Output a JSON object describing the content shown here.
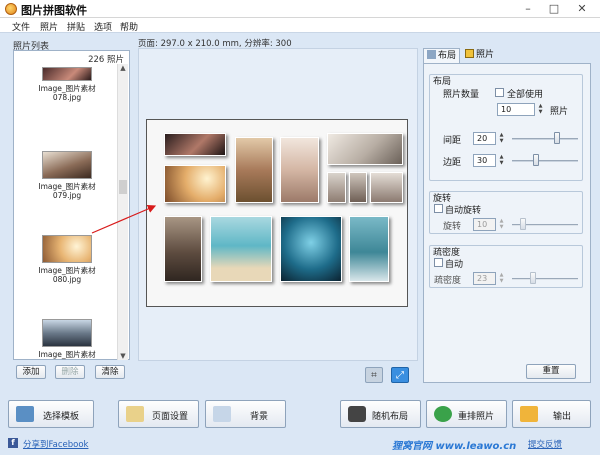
{
  "window": {
    "title": "图片拼图软件",
    "minimize": "–",
    "maximize": "□",
    "close": "✕"
  },
  "menu": [
    "文件",
    "照片",
    "拼贴",
    "选项",
    "帮助"
  ],
  "photo_list": {
    "title": "照片列表",
    "count": "226 照片",
    "items": [
      {
        "caption": "Image_图片素材\n078.jpg"
      },
      {
        "caption": "Image_图片素材\n079.jpg"
      },
      {
        "caption": "Image_图片素材\n080.jpg"
      },
      {
        "caption": "Image_图片素材"
      }
    ],
    "add_button": "添加",
    "delete_button": "删除",
    "clear_button": "清除"
  },
  "canvas": {
    "info": "页面: 297.0 x 210.0 mm, 分辨率: 300"
  },
  "tabs": {
    "layout": "布局",
    "photo": "照片"
  },
  "layout_group": {
    "label": "布局",
    "photo_count_label": "照片数量",
    "use_all_label": "全部使用",
    "photo_count_value": "10",
    "photo_unit": "照片",
    "spacing_label": "间距",
    "spacing_value": "20",
    "margin_label": "边距",
    "margin_value": "30"
  },
  "rotation_group": {
    "label": "旋转",
    "auto_label": "自动旋转",
    "rotate_label": "旋转",
    "rotate_value": "10"
  },
  "density_group": {
    "label": "疏密度",
    "auto_label": "自动",
    "density_label": "疏密度",
    "density_value": "23"
  },
  "reset_button": "重置",
  "bottom_buttons": {
    "template": "选择模板",
    "page_setup": "页面设置",
    "background": "背景",
    "random_layout": "随机布局",
    "rearrange": "重排照片",
    "export": "输出"
  },
  "footer": {
    "facebook": "分享到Facebook",
    "brand": "狸窝官网 www.leawo.cn",
    "feedback": "提交反馈"
  },
  "colors": {
    "accent": "#2a78d4",
    "link": "#2a63b8",
    "window_bg": "#dbe7f5"
  }
}
